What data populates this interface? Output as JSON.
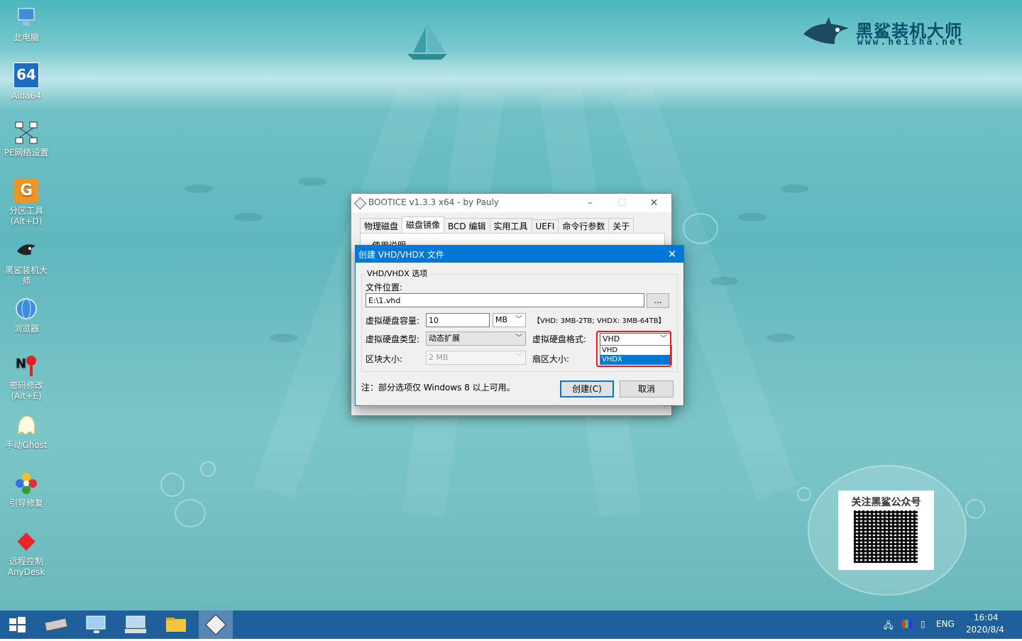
{
  "desktop_icons": [
    {
      "label": "此电脑",
      "icon": "computer-icon"
    },
    {
      "label": "Aida64",
      "icon": "aida64-icon"
    },
    {
      "label": "PE网络设置",
      "icon": "network-icon"
    },
    {
      "label": "分区工具\n(Alt+D)",
      "icon": "partition-tool-icon"
    },
    {
      "label": "黑鲨装机大\n师",
      "icon": "shark-icon"
    },
    {
      "label": "浏览器",
      "icon": "browser-icon"
    },
    {
      "label": "密码修改\n(Alt+E)",
      "icon": "password-icon"
    },
    {
      "label": "手动Ghost",
      "icon": "ghost-icon"
    },
    {
      "label": "引导修复",
      "icon": "boot-repair-icon"
    },
    {
      "label": "远程控制\nAnyDesk",
      "icon": "anydesk-icon"
    }
  ],
  "brand": {
    "name": "黑鲨装机大师",
    "url": "www.heisha.net"
  },
  "qr": {
    "title": "关注黑鲨公众号"
  },
  "main_window": {
    "title": "BOOTICE v1.3.3 x64 - by Pauly",
    "tabs": [
      "物理磁盘",
      "磁盘镜像",
      "BCD 编辑",
      "实用工具",
      "UEFI",
      "命令行参数",
      "关于"
    ],
    "selected_tab": "磁盘镜像",
    "partial_text": "使用说明"
  },
  "dialog": {
    "title": "创建 VHD/VHDX 文件",
    "group_label": "VHD/VHDX 选项",
    "file_location_label": "文件位置:",
    "file_location_value": "E:\\1.vhd",
    "browse_label": "...",
    "capacity_label": "虚拟硬盘容量:",
    "capacity_value": "10",
    "capacity_unit": "MB",
    "capacity_hint": "【VHD: 3MB-2TB; VHDX: 3MB-64TB】",
    "type_label": "虚拟硬盘类型:",
    "type_value": "动态扩展",
    "format_label": "虚拟硬盘格式:",
    "format_value": "VHD",
    "format_options": [
      "VHD",
      "VHDX"
    ],
    "format_highlighted": "VHDX",
    "block_label": "区块大小:",
    "block_value": "2 MB",
    "sector_label": "扇区大小:",
    "note": "注：部分选项仅 Windows 8 以上可用。",
    "create_label": "创建(C)",
    "cancel_label": "取消"
  },
  "taskbar": {
    "items": [
      "start-icon",
      "drive-icon",
      "network-settings-icon",
      "keyboard-icon",
      "folder-icon",
      "bootice-icon"
    ],
    "tray_lang": "ENG",
    "time": "16:04",
    "date": "2020/8/4"
  },
  "colors": {
    "accent": "#0078d7",
    "taskbar": "#1e5f9c",
    "highlight_box": "#e02020"
  }
}
